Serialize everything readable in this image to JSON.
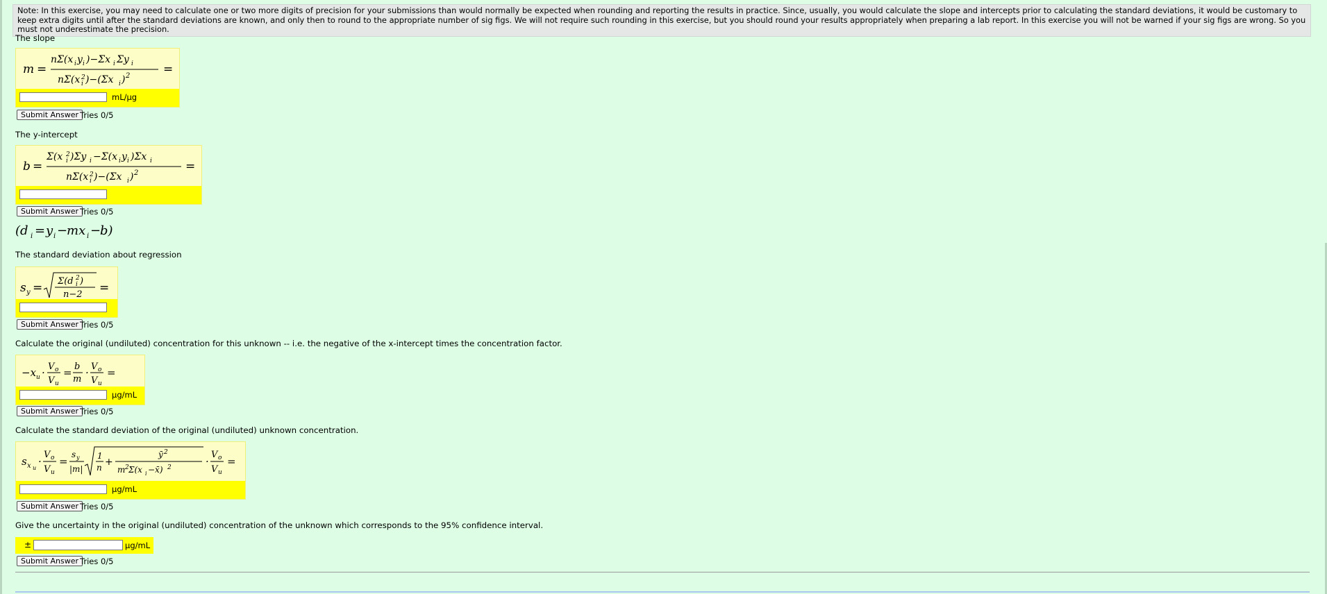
{
  "note": "Note: In this exercise, you may need to calculate one or two more digits of precision for your submissions than would normally be expected when rounding and reporting the results in practice. Since, usually, you would calculate the slope and intercepts prior to calculating the standard deviations, it would be customary to keep extra digits until after the standard deviations are known, and only then to round to the appropriate number of sig figs. We will not require such rounding in this exercise, but you should round your results appropriately when preparing a lab report. In this exercise you will not be warned if your sig figs are wrong. So you must not underestimate the precision.",
  "submit_label": "Submit Answer",
  "questions": [
    {
      "label": "The slope",
      "unit": "mL/μg",
      "tries": "Tries 0/5"
    },
    {
      "label": "The y-intercept",
      "unit": "",
      "tries": "Tries 0/5"
    },
    {
      "label": "The standard deviation about regression",
      "unit": "",
      "tries": "Tries 0/5"
    },
    {
      "label": "Calculate the original (undiluted) concentration for this unknown -- i.e. the negative of the x-intercept times the concentration factor.",
      "unit": "μg/mL",
      "tries": "Tries 0/5"
    },
    {
      "label": "Calculate the standard deviation of the original (undiluted) unknown concentration.",
      "unit": "μg/mL",
      "tries": "Tries 0/5"
    },
    {
      "label": "Give the uncertainty in the original (undiluted) concentration of the unknown which corresponds to the 95% confidence interval.",
      "unit": "μg/mL",
      "tries": "Tries 0/5",
      "prefix": "±"
    }
  ],
  "formulas": {
    "slope": {
      "lhs": "m=",
      "num": "nΣ(xᵢyᵢ)−ΣxᵢΣyᵢ",
      "den": "nΣ(xᵢ²)−(Σxᵢ)²"
    },
    "intercept": {
      "lhs": "b=",
      "num": "Σ(xᵢ²)Σyᵢ−Σ(xᵢyᵢ)Σxᵢ",
      "den": "nΣ(xᵢ²)−(Σxᵢ)²"
    },
    "residual": "(dᵢ=yᵢ−mxᵢ−b)",
    "sy": {
      "lhs": "s",
      "sub": "y",
      "num": "Σ(dᵢ²)",
      "den": "n−2"
    },
    "conc": "−xᵤ·Vₒ/Vᵤ = b/m·Vₒ/Vᵤ =",
    "sd": "sₓᵤ·Vₒ/Vᵤ = sᵧ/|m| √(1/n + ȳ²/(m²Σ(xᵢ−x̄)²)) ·Vₒ/Vᵤ ="
  }
}
